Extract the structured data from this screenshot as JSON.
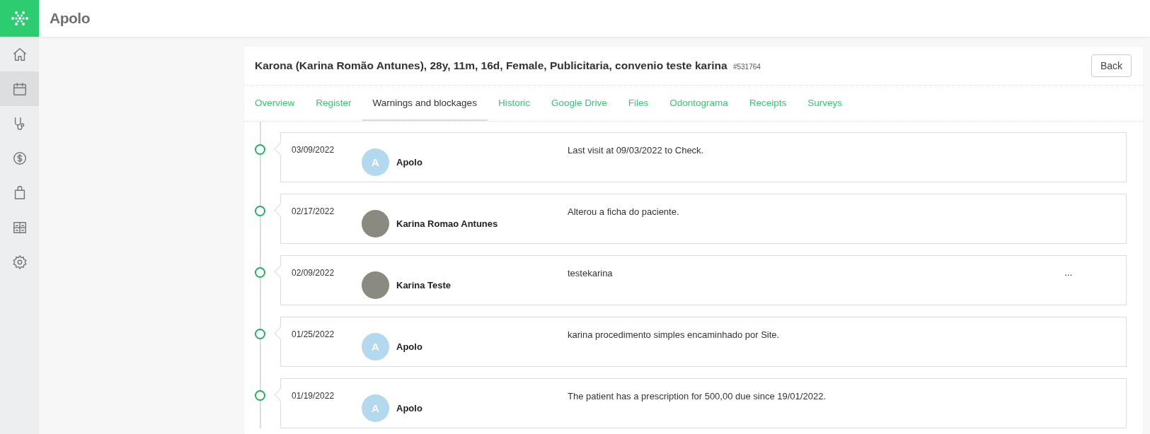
{
  "app": {
    "title": "Apolo"
  },
  "sidebar": {
    "items": [
      {
        "kind": "home",
        "selected": false
      },
      {
        "kind": "calendar",
        "selected": true
      },
      {
        "kind": "stethoscope",
        "selected": false
      },
      {
        "kind": "dollar",
        "selected": false
      },
      {
        "kind": "bag",
        "selected": false
      },
      {
        "kind": "grid",
        "selected": false
      },
      {
        "kind": "gear",
        "selected": false
      }
    ]
  },
  "patient": {
    "title": "Karona (Karina Romão Antunes), 28y, 11m, 16d, Female, Publicitaria, convenio teste karina",
    "id": "#531764",
    "back_button": "Back"
  },
  "tabs": [
    {
      "label": "Overview",
      "selected": false
    },
    {
      "label": "Register",
      "selected": false
    },
    {
      "label": "Warnings and blockages",
      "selected": true
    },
    {
      "label": "Historic",
      "selected": false
    },
    {
      "label": "Google Drive",
      "selected": false
    },
    {
      "label": "Files",
      "selected": false
    },
    {
      "label": "Odontograma",
      "selected": false
    },
    {
      "label": "Receipts",
      "selected": false
    },
    {
      "label": "Surveys",
      "selected": false
    }
  ],
  "timeline": [
    {
      "date": "03/09/2022",
      "avatar": {
        "kind": "initial",
        "letter": "A"
      },
      "author": "Apolo",
      "message": "Last visit at 09/03/2022 to Check."
    },
    {
      "date": "02/17/2022",
      "avatar": {
        "kind": "photo"
      },
      "author": "Karina Romao Antunes",
      "message": "Alterou a ficha do paciente."
    },
    {
      "date": "02/09/2022",
      "avatar": {
        "kind": "photo"
      },
      "author": "Karina Teste",
      "message": "testekarina",
      "menu": "..."
    },
    {
      "date": "01/25/2022",
      "avatar": {
        "kind": "initial",
        "letter": "A"
      },
      "author": "Apolo",
      "message": "karina procedimento simples encaminhado por Site."
    },
    {
      "date": "01/19/2022",
      "avatar": {
        "kind": "initial",
        "letter": "A"
      },
      "author": "Apolo",
      "message": "The patient has a prescription for 500,00 due since 19/01/2022."
    }
  ]
}
